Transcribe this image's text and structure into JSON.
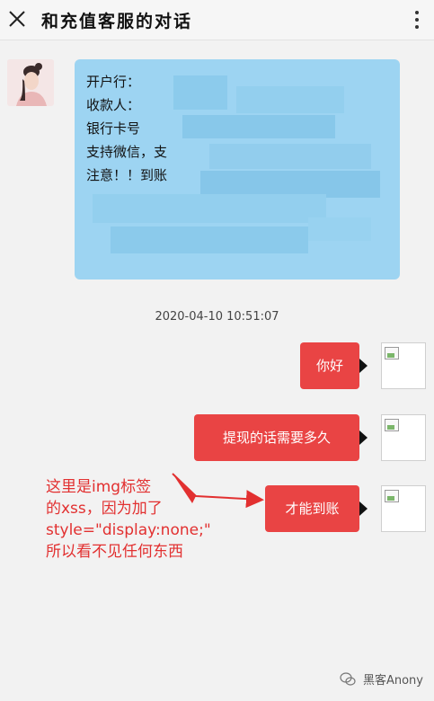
{
  "header": {
    "title": "和充值客服的对话"
  },
  "messages": {
    "service_lines": [
      "开户行：",
      "收款人：",
      "银行卡号",
      "支持微信，支",
      "注意！！到账"
    ],
    "timestamp": "2020-04-10 10:51:07",
    "user_messages": [
      "你好",
      "提现的话需要多久",
      "才能到账"
    ]
  },
  "annotation": {
    "lines": [
      "这里是img标签",
      "的xss，因为加了",
      "style=\"display:none;\"",
      "所以看不见任何东西"
    ]
  },
  "watermark": {
    "text": "黑客Anony"
  },
  "colors": {
    "service_bubble": "#9dd4f2",
    "user_bubble": "#e94444",
    "annotation_text": "#e23030",
    "background": "#f2f2f2"
  }
}
